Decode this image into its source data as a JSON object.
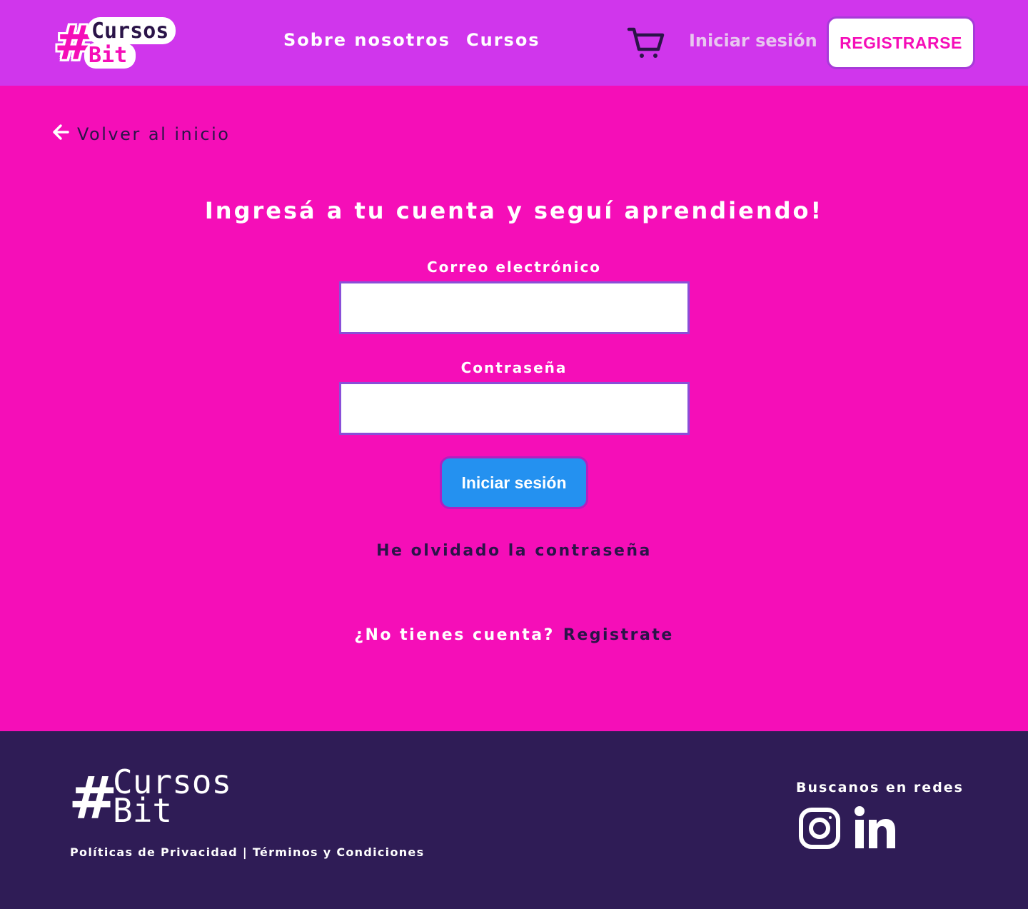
{
  "header": {
    "logo": {
      "hash": "#",
      "line1": "Cursos",
      "line2": "Bit"
    },
    "nav": {
      "about": "Sobre nosotros",
      "courses": "Cursos"
    },
    "cart_icon": "cart-icon",
    "login": "Iniciar sesión",
    "register": "REGISTRARSE"
  },
  "main": {
    "back": "Volver al inicio",
    "title": "Ingresá a tu cuenta y seguí aprendiendo!",
    "email_label": "Correo electrónico",
    "email_value": "",
    "password_label": "Contraseña",
    "password_value": "",
    "submit": "Iniciar sesión",
    "forgot": "He olvidado la contraseña",
    "no_account": "¿No tienes cuenta?",
    "register_link": "Registrate"
  },
  "footer": {
    "logo": {
      "hash": "#",
      "line1": "Cursos",
      "line2": "Bit"
    },
    "links": "Políticas de Privacidad | Términos y Condiciones",
    "social_title": "Buscanos en redes",
    "icons": [
      "instagram-icon",
      "linkedin-icon"
    ]
  },
  "colors": {
    "header_bg": "#d036ec",
    "page_bg": "#f50eb8",
    "footer_bg": "#2f1c56",
    "primary_button": "#2491f0",
    "dark_text": "#2a1448"
  }
}
